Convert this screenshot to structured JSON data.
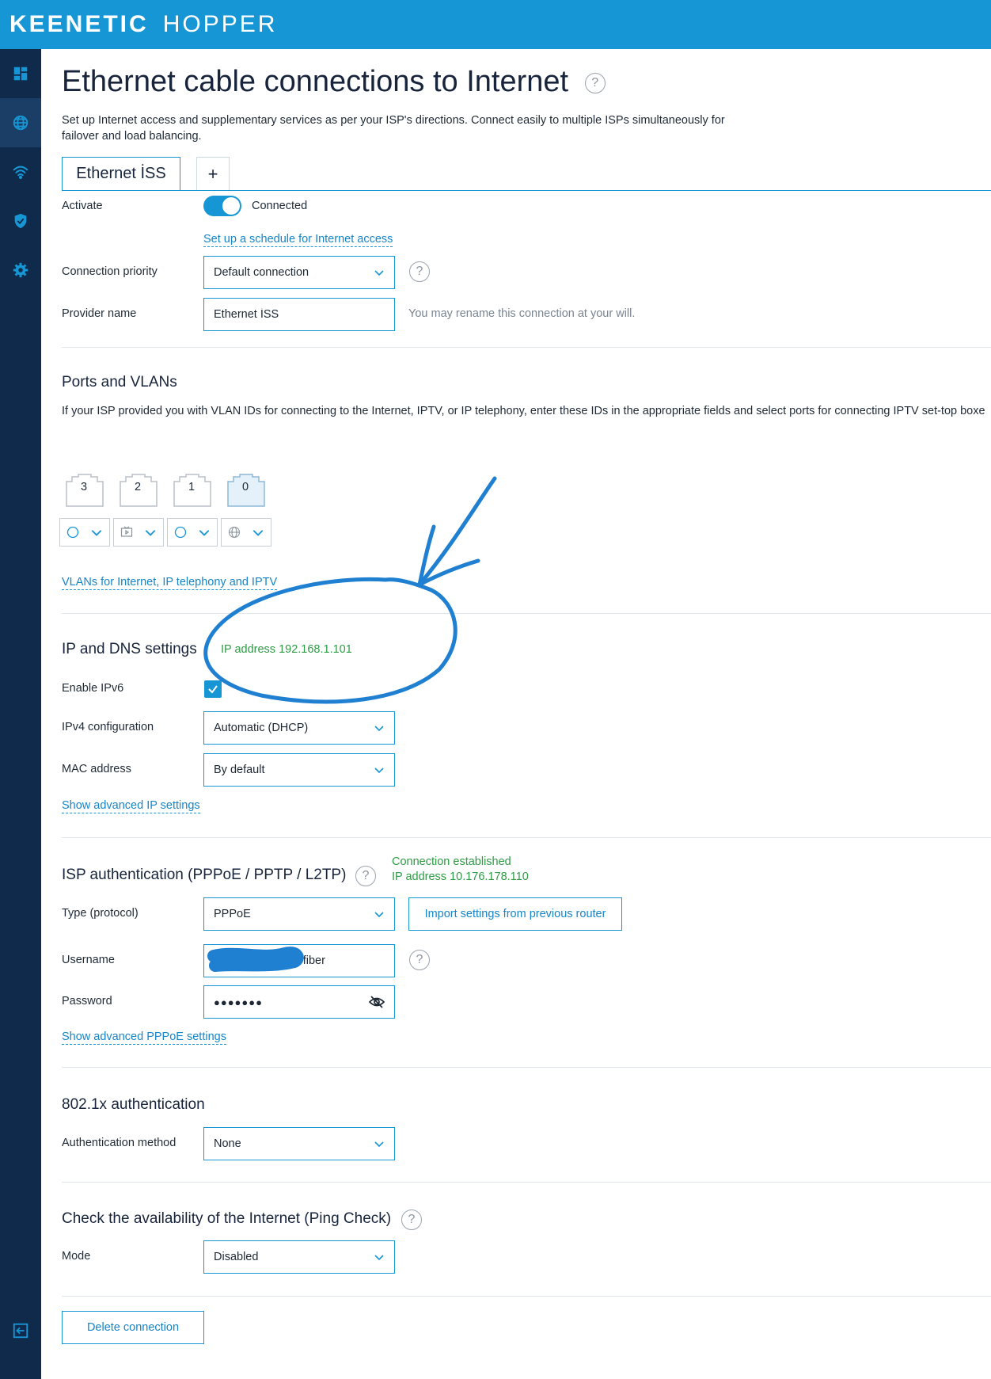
{
  "brand": {
    "part1": "KEENETIC",
    "part2": "HOPPER"
  },
  "sidebar": {
    "items": [
      {
        "icon": "dashboard-icon"
      },
      {
        "icon": "globe-icon"
      },
      {
        "icon": "wifi-icon"
      },
      {
        "icon": "shield-icon"
      },
      {
        "icon": "gear-icon"
      },
      {
        "icon": "logout-icon"
      }
    ]
  },
  "page": {
    "title": "Ethernet cable connections to Internet",
    "description": "Set up Internet access and supplementary services as per your ISP's directions. Connect easily to multiple ISPs simultaneously for failover and load balancing.",
    "help": "?"
  },
  "tabs": {
    "active": "Ethernet İSS",
    "add": "+"
  },
  "general": {
    "activate_label": "Activate",
    "activate_status": "Connected",
    "schedule_link": "Set up a schedule for Internet access",
    "priority_label": "Connection priority",
    "priority_value": "Default connection",
    "provider_label": "Provider name",
    "provider_value": "Ethernet İSS",
    "provider_hint": "You may rename this connection at your will."
  },
  "ports": {
    "title": "Ports and VLANs",
    "description": "If your ISP provided you with VLAN IDs for connecting to the Internet, IPTV, or IP telephony, enter these IDs in the appropriate fields and select ports for connecting IPTV set-top boxe",
    "items": [
      {
        "number": "3",
        "mode_icon": "circle-icon"
      },
      {
        "number": "2",
        "mode_icon": "tv-icon"
      },
      {
        "number": "1",
        "mode_icon": "circle-icon"
      },
      {
        "number": "0",
        "mode_icon": "globe-icon"
      }
    ],
    "vlan_link": "VLANs for Internet, IP telephony and IPTV"
  },
  "ipdns": {
    "title": "IP and DNS settings",
    "ip_status": "IP address 192.168.1.101",
    "ipv6_label": "Enable IPv6",
    "ipv6_checked": true,
    "ipv4_label": "IPv4 configuration",
    "ipv4_value": "Automatic (DHCP)",
    "mac_label": "MAC address",
    "mac_value": "By default",
    "advanced_link": "Show advanced IP settings"
  },
  "isp_auth": {
    "title": "ISP authentication (PPPoE / PPTP / L2TP)",
    "status_line1": "Connection established",
    "status_line2": "IP address 10.176.178.110",
    "type_label": "Type (protocol)",
    "type_value": "PPPoE",
    "import_button": "Import settings from previous router",
    "username_label": "Username",
    "username_value": "@fiber",
    "password_label": "Password",
    "password_value": "●●●●●●●",
    "advanced_link": "Show advanced PPPoE settings"
  },
  "dot1x": {
    "title": "802.1x authentication",
    "method_label": "Authentication method",
    "method_value": "None"
  },
  "ping_check": {
    "title": "Check the availability of the Internet (Ping Check)",
    "mode_label": "Mode",
    "mode_value": "Disabled"
  },
  "actions": {
    "delete_button": "Delete connection"
  },
  "colors": {
    "accent": "#1796d5",
    "sidebar": "#0f2a4a",
    "success": "#2e9b45"
  }
}
